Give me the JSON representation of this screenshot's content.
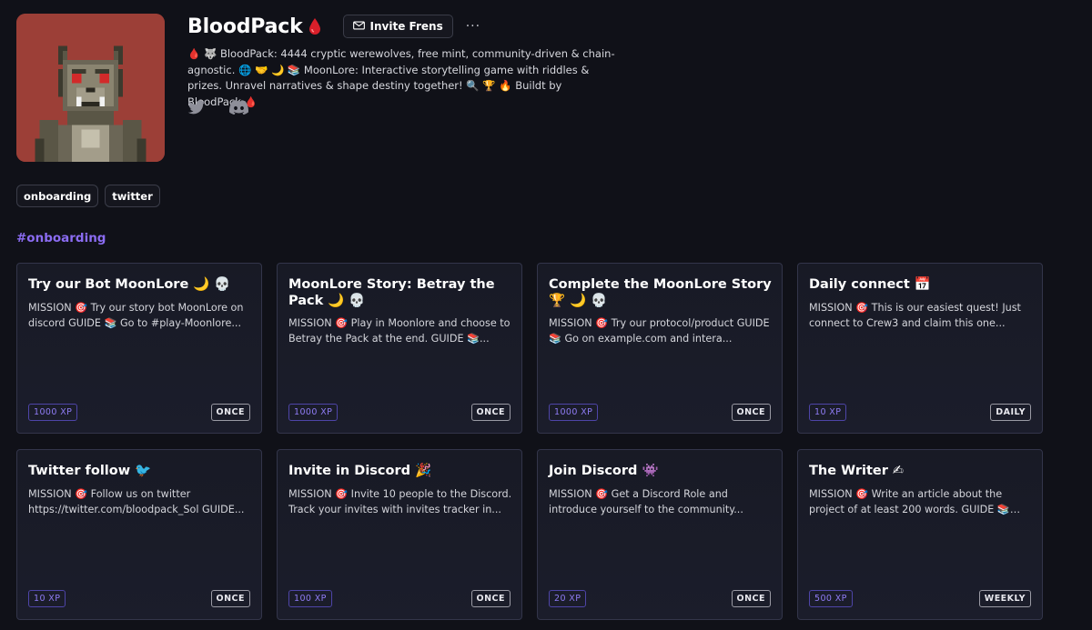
{
  "profile": {
    "name": "BloodPack",
    "title_emoji": "🩸",
    "invite_label": "Invite Frens",
    "more_label": "···",
    "bio": "🩸 🐺 BloodPack: 4444 cryptic werewolves, free mint, community-driven & chain-agnostic. 🌐 🤝 🌙 📚 MoonLore: Interactive storytelling game with riddles & prizes. Unravel narratives & shape destiny together! 🔍 🏆 🔥 Buildt by BloodPack 🩸",
    "socials": [
      "twitter-icon",
      "discord-icon"
    ]
  },
  "tags": [
    "onboarding",
    "twitter"
  ],
  "section": "#onboarding",
  "colors": {
    "background": "#101118",
    "accent": "#8b6cf2",
    "avatar_bg": "#9c3f37",
    "card_border": "#33354a"
  },
  "quests": [
    {
      "title": "Try our Bot MoonLore 🌙 💀",
      "desc": "MISSION 🎯 Try our story bot MoonLore on discord GUIDE 📚 Go to #play-Moonlore...",
      "xp": "1000 XP",
      "freq": "ONCE"
    },
    {
      "title": "MoonLore Story: Betray the Pack 🌙 💀",
      "desc": "MISSION 🎯 Play in Moonlore and choose to Betray the Pack at the end. GUIDE 📚...",
      "xp": "1000 XP",
      "freq": "ONCE"
    },
    {
      "title": "Complete the MoonLore Story 🏆 🌙 💀",
      "desc": "MISSION 🎯 Try our protocol/product GUIDE 📚 Go on example.com and intera...",
      "xp": "1000 XP",
      "freq": "ONCE"
    },
    {
      "title": "Daily connect 📅",
      "desc": "MISSION 🎯 This is our easiest quest! Just connect to Crew3 and claim this one...",
      "xp": "10 XP",
      "freq": "DAILY"
    },
    {
      "title": "Twitter follow 🐦",
      "desc": "MISSION 🎯 Follow us on twitter https://twitter.com/bloodpack_Sol GUIDE...",
      "xp": "10 XP",
      "freq": "ONCE"
    },
    {
      "title": "Invite in Discord 🎉",
      "desc": "MISSION 🎯 Invite 10 people to the Discord. Track your invites with invites tracker in...",
      "xp": "100 XP",
      "freq": "ONCE"
    },
    {
      "title": "Join Discord 👾",
      "desc": "MISSION 🎯 Get a Discord Role and introduce yourself to the community...",
      "xp": "20 XP",
      "freq": "ONCE"
    },
    {
      "title": "The Writer ✍",
      "desc": "MISSION 🎯 Write an article about the project of at least 200 words. GUIDE 📚 Be...",
      "xp": "500 XP",
      "freq": "WEEKLY"
    }
  ]
}
